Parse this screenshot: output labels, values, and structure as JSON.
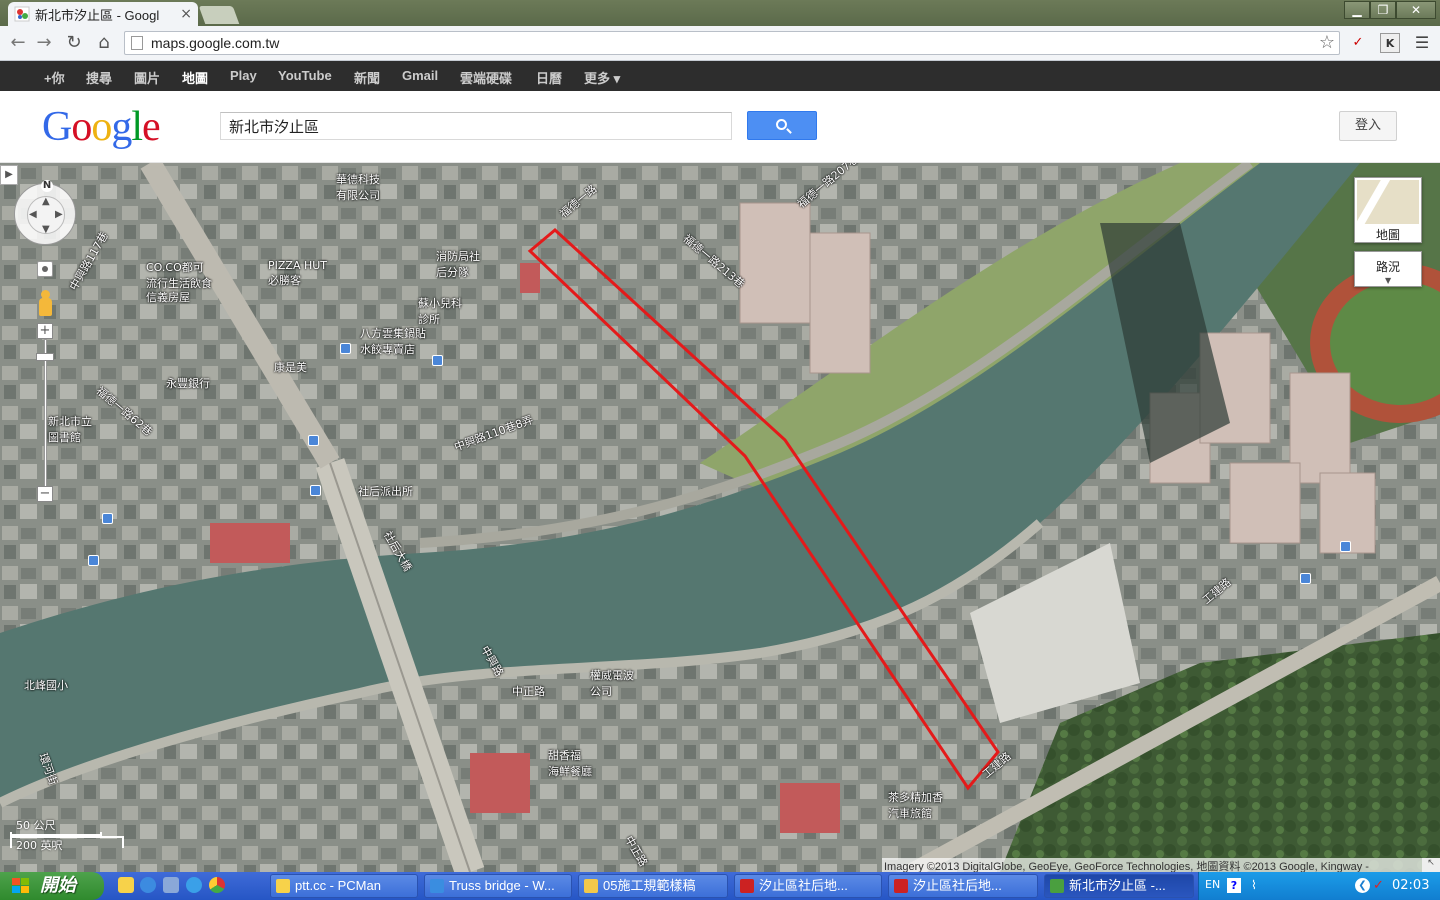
{
  "browser": {
    "tab_title": "新北市汐止區 - Googl",
    "tab_close": "×",
    "url": "maps.google.com.tw",
    "window_controls": {
      "minimize": "▁",
      "maximize": "❐",
      "close": "✕"
    },
    "ext_k": "K"
  },
  "gbar": {
    "items": [
      "+你",
      "搜尋",
      "圖片",
      "地圖",
      "Play",
      "YouTube",
      "新聞",
      "Gmail",
      "雲端硬碟",
      "日曆",
      "更多 ▾"
    ],
    "active_index": 3
  },
  "header": {
    "logo": "Google",
    "search_value": "新北市汐止區",
    "signin_label": "登入"
  },
  "map": {
    "compass_n": "N",
    "map_type_label": "地圖",
    "traffic_label": "路況",
    "scale_metric": "50 公尺",
    "scale_imperial": "200 英呎",
    "attribution": "Imagery ©2013 DigitalGlobe, GeoEye, GeoForce Technologies, 地圖資料 ©2013 Google, Kingway -",
    "labels": [
      {
        "text": "華德科技\n有限公司"
      },
      {
        "text": "福德一路"
      },
      {
        "text": "福德一路207巷"
      },
      {
        "text": "消防局社\n后分隊"
      },
      {
        "text": "PIZZA HUT\n必勝客"
      },
      {
        "text": "CO.CO都可\n流行生活飲食"
      },
      {
        "text": "信義房屋"
      },
      {
        "text": "中興路117巷"
      },
      {
        "text": "蘇小兒科\n診所"
      },
      {
        "text": "八方雲集鍋貼\n水餃專賣店"
      },
      {
        "text": "福德一路213巷"
      },
      {
        "text": "康是美"
      },
      {
        "text": "永豐銀行"
      },
      {
        "text": "新北市立\n圖書館"
      },
      {
        "text": "福德一路62巷"
      },
      {
        "text": "中興路110巷8弄"
      },
      {
        "text": "社后派出所"
      },
      {
        "text": "社后大橋"
      },
      {
        "text": "中興路"
      },
      {
        "text": "北峰國小"
      },
      {
        "text": "環河街"
      },
      {
        "text": "中正路"
      },
      {
        "text": "權威電波\n公司"
      },
      {
        "text": "甜香福\n海鮮餐廳"
      },
      {
        "text": "茶多精加香\n汽車旅館"
      },
      {
        "text": "工建路"
      },
      {
        "text": "工建路"
      },
      {
        "text": "中正路"
      }
    ]
  },
  "taskbar": {
    "start_label": "開始",
    "tasks": [
      {
        "label": "ptt.cc - PCMan",
        "icon_color": "#f7d24a"
      },
      {
        "label": "Truss bridge - W...",
        "icon_color": "#3a8de0"
      },
      {
        "label": "05施工規範樣稿",
        "icon_color": "#f2c84a"
      },
      {
        "label": "汐止區社后地...",
        "icon_color": "#c22"
      },
      {
        "label": "汐止區社后地...",
        "icon_color": "#c22"
      },
      {
        "label": "新北市汐止區 -...",
        "icon_color": "#4a9f3f",
        "active": true
      }
    ],
    "tray_lang": "EN",
    "tray_help": "?",
    "clock": "02:03"
  }
}
